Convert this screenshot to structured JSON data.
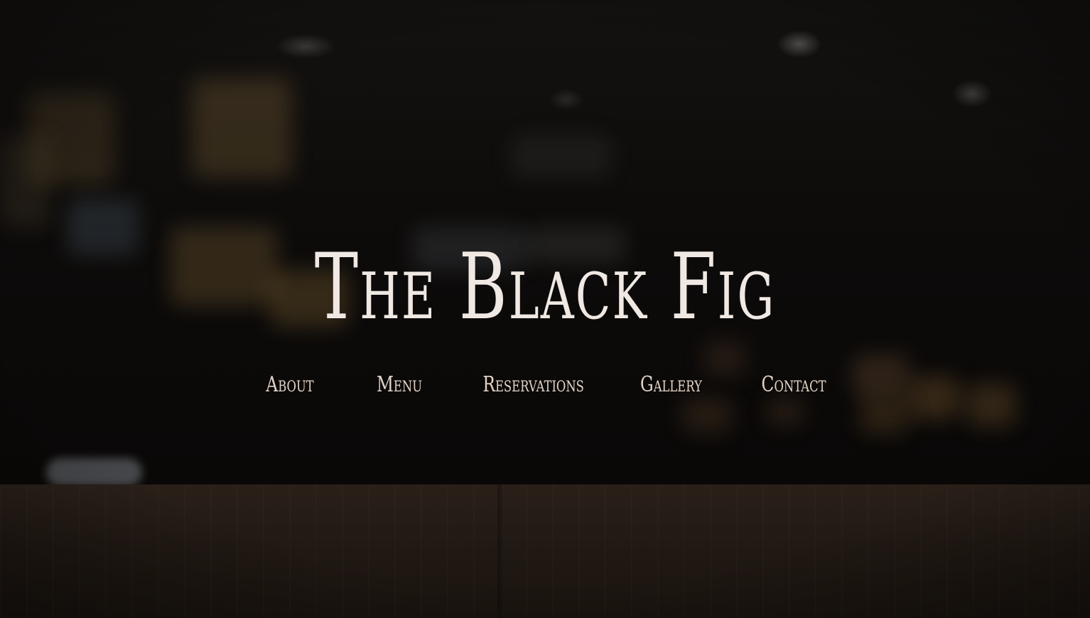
{
  "site": {
    "title": "The Black Fig"
  },
  "nav": {
    "items": [
      {
        "label": "About"
      },
      {
        "label": "Menu"
      },
      {
        "label": "Reservations"
      },
      {
        "label": "Gallery"
      },
      {
        "label": "Contact"
      }
    ]
  },
  "colors": {
    "title_text": "#efe8e3",
    "nav_text": "#e2d4c8",
    "background": "#0b0908"
  }
}
